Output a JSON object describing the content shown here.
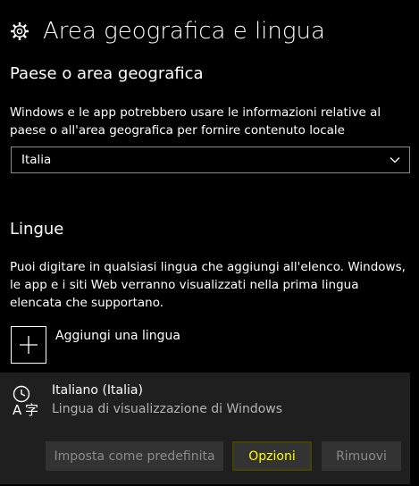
{
  "header": {
    "title": "Area geografica e lingua",
    "icon": "gear-icon"
  },
  "region": {
    "title": "Paese o area geografica",
    "description": "Windows e le app potrebbero usare le informazioni relative al paese o all'area geografica per fornire contenuto locale",
    "selected": "Italia"
  },
  "languages": {
    "title": "Lingue",
    "description": "Puoi digitare in qualsiasi lingua che aggiungi all'elenco. Windows, le app e i siti Web verranno visualizzati nella prima lingua elencata che supportano.",
    "add_label": "Aggiungi una lingua",
    "items": [
      {
        "name": "Italiano (Italia)",
        "subtitle": "Lingua di visualizzazione di Windows",
        "buttons": {
          "set_default": "Imposta come predefinita",
          "options": "Opzioni",
          "remove": "Rimuovi"
        }
      }
    ]
  },
  "colors": {
    "background": "#000000",
    "card": "#1f1f1f",
    "highlight": "#ffff00",
    "disabled_text": "#8a8a8a"
  }
}
